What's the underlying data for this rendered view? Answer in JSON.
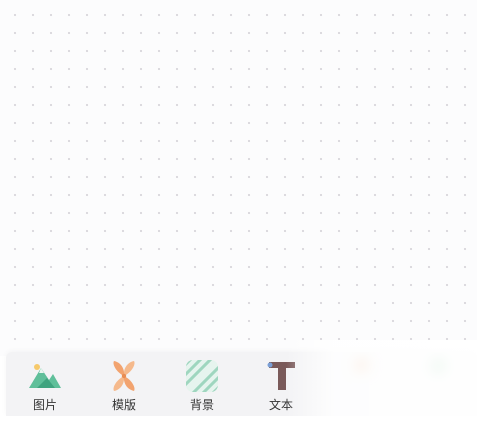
{
  "toolbar": {
    "items": [
      {
        "label": "图片",
        "icon": "mountain-image-icon"
      },
      {
        "label": "模版",
        "icon": "flower-template-icon"
      },
      {
        "label": "背景",
        "icon": "striped-background-icon"
      },
      {
        "label": "文本",
        "icon": "text-t-icon"
      },
      {
        "label": "",
        "icon": "orange-blurred-icon"
      },
      {
        "label": "",
        "icon": "green-blurred-icon"
      }
    ]
  },
  "colors": {
    "canvas_dot": "#d8d6dc",
    "toolbar_bg": "#f3f3f5",
    "mountain_green": "#5fbf9a",
    "flower_orange": "#f2a36f",
    "stripe_green": "#9fd6bf",
    "text_t_brown": "#7a5a5a"
  }
}
